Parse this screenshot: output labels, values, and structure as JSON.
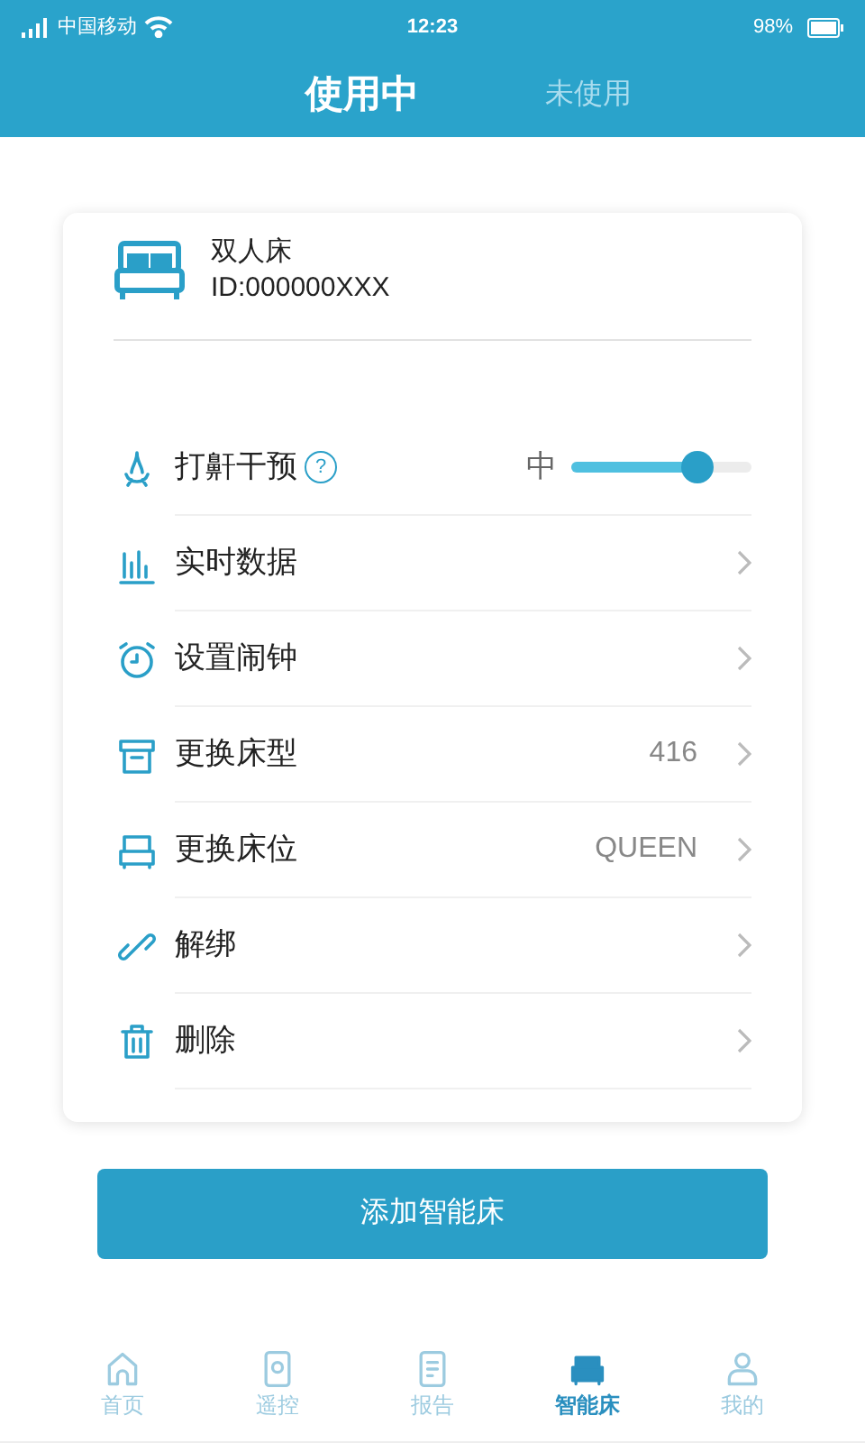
{
  "status_bar": {
    "carrier": "中国移动",
    "time": "12:23",
    "battery": "98%"
  },
  "tabs": [
    {
      "label": "使用中",
      "selected": true
    },
    {
      "label": "未使用",
      "selected": false
    }
  ],
  "device": {
    "name": "双人床",
    "id": "ID:000000XXX"
  },
  "rows": [
    {
      "kind": "slider",
      "label": "打鼾干预",
      "help": "?",
      "reading": "中",
      "level": 0.7
    },
    {
      "kind": "link",
      "label": "实时数据"
    },
    {
      "kind": "link",
      "label": "设置闹钟"
    },
    {
      "kind": "link",
      "label": "更换床型",
      "value": "416"
    },
    {
      "kind": "link",
      "label": "更换床位",
      "value": "QUEEN"
    },
    {
      "kind": "link",
      "label": "解绑"
    },
    {
      "kind": "link",
      "label": "删除"
    }
  ],
  "add_button": "添加智能床",
  "bottom_nav": [
    {
      "label": "首页",
      "selected": false
    },
    {
      "label": "遥控",
      "selected": false
    },
    {
      "label": "报告",
      "selected": false
    },
    {
      "label": "智能床",
      "selected": true
    },
    {
      "label": "我的",
      "selected": false
    }
  ]
}
